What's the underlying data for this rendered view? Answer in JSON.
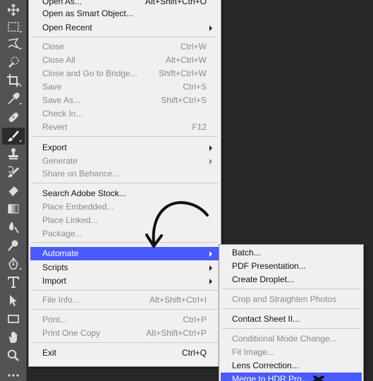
{
  "toolbar": {
    "tools": [
      {
        "name": "move-tool-icon"
      },
      {
        "name": "marquee-tool-icon"
      },
      {
        "name": "lasso-tool-icon"
      },
      {
        "name": "quick-selection-tool-icon"
      },
      {
        "name": "crop-tool-icon"
      },
      {
        "name": "eyedropper-tool-icon"
      },
      {
        "name": "healing-brush-tool-icon"
      },
      {
        "name": "brush-tool-icon"
      },
      {
        "name": "clone-stamp-tool-icon"
      },
      {
        "name": "history-brush-tool-icon"
      },
      {
        "name": "eraser-tool-icon"
      },
      {
        "name": "gradient-tool-icon"
      },
      {
        "name": "blur-tool-icon"
      },
      {
        "name": "dodge-tool-icon"
      },
      {
        "name": "pen-tool-icon"
      },
      {
        "name": "type-tool-icon"
      },
      {
        "name": "path-selection-tool-icon"
      },
      {
        "name": "rectangle-tool-icon"
      },
      {
        "name": "hand-tool-icon"
      },
      {
        "name": "zoom-tool-icon"
      },
      {
        "name": "more-tools-icon"
      }
    ],
    "active_tool": "brush-tool-icon"
  },
  "file_menu": {
    "items": {
      "open_as": {
        "label": "Open As...",
        "shortcut": "Alt+Shift+Ctrl+O"
      },
      "open_smart": {
        "label": "Open as Smart Object..."
      },
      "open_recent": {
        "label": "Open Recent"
      },
      "close": {
        "label": "Close",
        "shortcut": "Ctrl+W"
      },
      "close_all": {
        "label": "Close All",
        "shortcut": "Alt+Ctrl+W"
      },
      "close_bridge": {
        "label": "Close and Go to Bridge...",
        "shortcut": "Shift+Ctrl+W"
      },
      "save": {
        "label": "Save",
        "shortcut": "Ctrl+S"
      },
      "save_as": {
        "label": "Save As...",
        "shortcut": "Shift+Ctrl+S"
      },
      "check_in": {
        "label": "Check In..."
      },
      "revert": {
        "label": "Revert",
        "shortcut": "F12"
      },
      "export": {
        "label": "Export"
      },
      "generate": {
        "label": "Generate"
      },
      "share_behance": {
        "label": "Share on Behance..."
      },
      "search_stock": {
        "label": "Search Adobe Stock..."
      },
      "place_embedded": {
        "label": "Place Embedded..."
      },
      "place_linked": {
        "label": "Place Linked..."
      },
      "package": {
        "label": "Package..."
      },
      "automate": {
        "label": "Automate"
      },
      "scripts": {
        "label": "Scripts"
      },
      "import": {
        "label": "Import"
      },
      "file_info": {
        "label": "File Info...",
        "shortcut": "Alt+Shift+Ctrl+I"
      },
      "print": {
        "label": "Print...",
        "shortcut": "Ctrl+P"
      },
      "print_one": {
        "label": "Print One Copy",
        "shortcut": "Alt+Shift+Ctrl+P"
      },
      "exit": {
        "label": "Exit",
        "shortcut": "Ctrl+Q"
      }
    }
  },
  "automate_submenu": {
    "items": {
      "batch": {
        "label": "Batch..."
      },
      "pdf_presentation": {
        "label": "PDF Presentation..."
      },
      "create_droplet": {
        "label": "Create Droplet..."
      },
      "crop_straighten": {
        "label": "Crop and Straighten Photos"
      },
      "contact_sheet": {
        "label": "Contact Sheet II..."
      },
      "conditional_mode": {
        "label": "Conditional Mode Change..."
      },
      "fit_image": {
        "label": "Fit Image..."
      },
      "lens_correction": {
        "label": "Lens Correction..."
      },
      "merge_hdr": {
        "label": "Merge to HDR Pro..."
      }
    }
  },
  "colors": {
    "highlight": "#4a5bff",
    "menu_bg": "#f0f0f0",
    "toolbar_bg": "#535353",
    "canvas_bg": "#282828"
  }
}
